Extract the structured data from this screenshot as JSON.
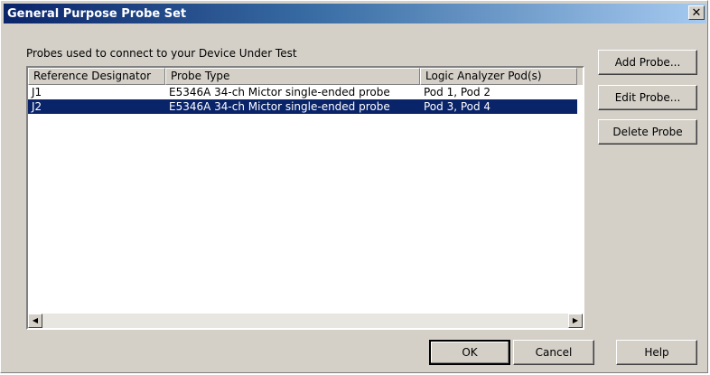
{
  "window": {
    "title": "General Purpose Probe Set"
  },
  "group_label": "Probes used to connect to your Device Under Test",
  "table": {
    "columns": [
      "Reference Designator",
      "Probe Type",
      "Logic Analyzer Pod(s)"
    ],
    "rows": [
      {
        "ref": "J1",
        "type": "E5346A 34-ch Mictor single-ended probe",
        "pods": "Pod 1, Pod 2",
        "selected": false
      },
      {
        "ref": "J2",
        "type": "E5346A 34-ch Mictor single-ended probe",
        "pods": "Pod 3, Pod 4",
        "selected": true
      }
    ]
  },
  "side_buttons": {
    "add": "Add Probe...",
    "edit": "Edit Probe...",
    "delete": "Delete Probe"
  },
  "bottom_buttons": {
    "ok": "OK",
    "cancel": "Cancel",
    "help": "Help"
  },
  "icons": {
    "close": "close-icon",
    "scroll_left": "arrow-left-icon",
    "scroll_right": "arrow-right-icon"
  },
  "colors": {
    "selection": "#0a246a",
    "titlebar": "#0a246a",
    "face": "#d4d0c8"
  }
}
